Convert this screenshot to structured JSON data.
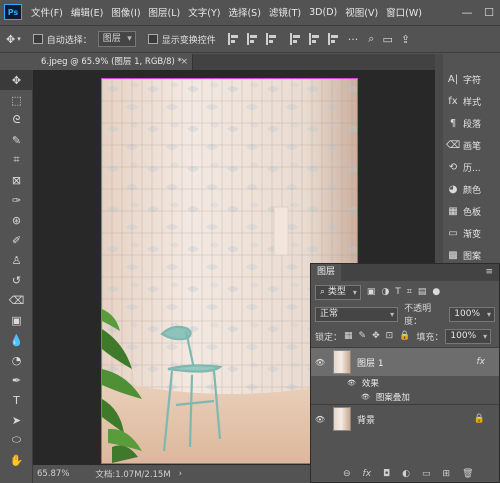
{
  "menubar": {
    "logo": "Ps",
    "items": [
      "文件(F)",
      "编辑(E)",
      "图像(I)",
      "图层(L)",
      "文字(Y)",
      "选择(S)",
      "滤镜(T)",
      "3D(D)",
      "视图(V)",
      "窗口(W)"
    ],
    "minimize": "—",
    "maximize": "☐"
  },
  "options": {
    "auto_select_label": "自动选择：",
    "auto_select_value": "图层",
    "show_transform_label": "显示变换控件"
  },
  "document": {
    "tab_title": "6.jpeg @ 65.9% (图层 1, RGB/8) *",
    "close": "×"
  },
  "tools": [
    "move-tool",
    "marquee-tool",
    "lasso-tool",
    "quick-select-tool",
    "crop-tool",
    "frame-tool",
    "eyedropper-tool",
    "healing-tool",
    "brush-tool",
    "stamp-tool",
    "history-brush-tool",
    "eraser-tool",
    "gradient-tool",
    "blur-tool",
    "dodge-tool",
    "pen-tool",
    "type-tool",
    "path-select-tool",
    "shape-tool",
    "hand-tool"
  ],
  "right_panel": {
    "items": [
      {
        "icon": "A|",
        "label": "字符"
      },
      {
        "icon": "fx",
        "label": "样式"
      },
      {
        "icon": "¶",
        "label": "段落"
      },
      {
        "icon": "⌫",
        "label": "画笔"
      },
      {
        "icon": "⟲",
        "label": "历..."
      },
      {
        "icon": "◕",
        "label": "颜色"
      },
      {
        "icon": "▦",
        "label": "色板"
      },
      {
        "icon": "▭",
        "label": "渐变"
      },
      {
        "icon": "▩",
        "label": "图案"
      }
    ]
  },
  "status": {
    "zoom": "65.87%",
    "doc_info": "文档:1.07M/2.15M"
  },
  "layers_panel": {
    "tab": "图层",
    "filter_kind": "类型",
    "blend_mode": "正常",
    "opacity_label": "不透明度：",
    "opacity_value": "100%",
    "lock_label": "锁定：",
    "fill_label": "填充：",
    "fill_value": "100%",
    "layers": [
      {
        "name": "图层 1",
        "fx": "fx",
        "effects_label": "效果",
        "effect": "图案叠加"
      },
      {
        "name": "背景",
        "lock": "🔒"
      }
    ],
    "bottom_icons": [
      "⊖",
      "fx",
      "◘",
      "◐",
      "▭",
      "⊞",
      "🗑"
    ]
  },
  "colors": {
    "ui_bg": "#535353",
    "canvas_bg": "#282828",
    "selection_border": "#d04ad0",
    "accent_logo": "#31a8ff"
  }
}
